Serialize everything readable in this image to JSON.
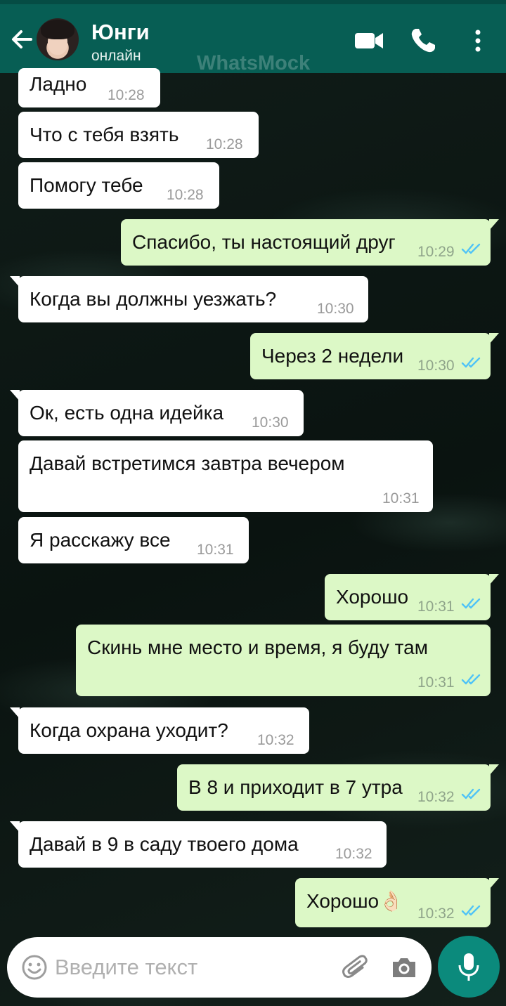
{
  "header": {
    "contact_name": "Юнги",
    "status": "онлайн",
    "watermark": "WhatsMock",
    "color": "#075e54"
  },
  "messages": [
    {
      "dir": "in",
      "text": "Ладно",
      "time": "10:28"
    },
    {
      "dir": "in",
      "text": "Что с тебя взять",
      "time": "10:28"
    },
    {
      "dir": "in",
      "text": "Помогу тебе",
      "time": "10:28"
    },
    {
      "dir": "out",
      "text": "Спасибо, ты настоящий друг",
      "time": "10:29",
      "read": true
    },
    {
      "dir": "in",
      "text": "Когда вы должны уезжать?",
      "time": "10:30"
    },
    {
      "dir": "out",
      "text": "Через 2 недели",
      "time": "10:30",
      "read": true
    },
    {
      "dir": "in",
      "text": "Ок, есть одна идейка",
      "time": "10:30"
    },
    {
      "dir": "in",
      "text": "Давай встретимся завтра вечером",
      "time": "10:31"
    },
    {
      "dir": "in",
      "text": "Я расскажу все",
      "time": "10:31"
    },
    {
      "dir": "out",
      "text": "Хорошо",
      "time": "10:31",
      "read": true
    },
    {
      "dir": "out",
      "text": "Скинь мне место и время, я буду там",
      "time": "10:31",
      "read": true
    },
    {
      "dir": "in",
      "text": "Когда охрана уходит?",
      "time": "10:32"
    },
    {
      "dir": "out",
      "text": "В 8 и приходит в 7 утра",
      "time": "10:32",
      "read": true
    },
    {
      "dir": "in",
      "text": "Давай в 9 в саду твоего дома",
      "time": "10:32"
    },
    {
      "dir": "out",
      "text": "Хорошо👌🏻",
      "time": "10:32",
      "read": true
    }
  ],
  "input": {
    "placeholder": "Введите текст"
  },
  "colors": {
    "incoming_bubble": "#ffffff",
    "outgoing_bubble": "#dcf8c6",
    "read_ticks": "#4fc3f7",
    "mic_button": "#0b8a7c"
  }
}
